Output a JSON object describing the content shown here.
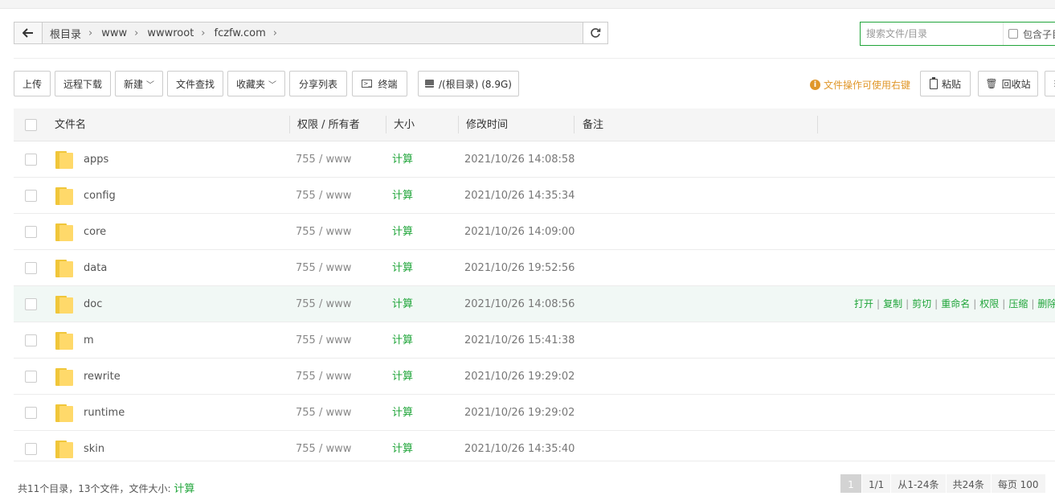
{
  "path": {
    "crumbs": [
      "根目录",
      "www",
      "wwwroot",
      "fczfw.com"
    ]
  },
  "search": {
    "placeholder": "搜索文件/目录",
    "include_subdir_label": "包含子目"
  },
  "toolbar": {
    "upload": "上传",
    "remote_download": "远程下载",
    "new": "新建",
    "find": "文件查找",
    "favorites": "收藏夹",
    "share_list": "分享列表",
    "terminal": "终端",
    "disk": "/(根目录) (8.9G)",
    "tip": "文件操作可使用右键",
    "paste": "粘贴",
    "recycle_bin": "回收站"
  },
  "table": {
    "headers": {
      "name": "文件名",
      "perm": "权限 / 所有者",
      "size": "大小",
      "mtime": "修改时间",
      "note": "备注"
    },
    "rows": [
      {
        "name": "apps",
        "perm": "755 / www",
        "size": "计算",
        "mtime": "2021/10/26 14:08:58"
      },
      {
        "name": "config",
        "perm": "755 / www",
        "size": "计算",
        "mtime": "2021/10/26 14:35:34"
      },
      {
        "name": "core",
        "perm": "755 / www",
        "size": "计算",
        "mtime": "2021/10/26 14:09:00"
      },
      {
        "name": "data",
        "perm": "755 / www",
        "size": "计算",
        "mtime": "2021/10/26 19:52:56"
      },
      {
        "name": "doc",
        "perm": "755 / www",
        "size": "计算",
        "mtime": "2021/10/26 14:08:56"
      },
      {
        "name": "m",
        "perm": "755 / www",
        "size": "计算",
        "mtime": "2021/10/26 15:41:38"
      },
      {
        "name": "rewrite",
        "perm": "755 / www",
        "size": "计算",
        "mtime": "2021/10/26 19:29:02"
      },
      {
        "name": "runtime",
        "perm": "755 / www",
        "size": "计算",
        "mtime": "2021/10/26 19:29:02"
      },
      {
        "name": "skin",
        "perm": "755 / www",
        "size": "计算",
        "mtime": "2021/10/26 14:35:40"
      }
    ],
    "row_actions": [
      "打开",
      "复制",
      "剪切",
      "重命名",
      "权限",
      "压缩",
      "删除"
    ]
  },
  "footer": {
    "summary_prefix": "共11个目录，13个文件，文件大小: ",
    "summary_calc": "计算",
    "pager": {
      "current": "1",
      "pages": "1/1",
      "range": "从1-24条",
      "total": "共24条",
      "per_page": "每页 100"
    }
  },
  "colors": {
    "accent_green": "#20a53a",
    "tip_orange": "#e0972a",
    "folder_yellow": "#ffd96a"
  }
}
